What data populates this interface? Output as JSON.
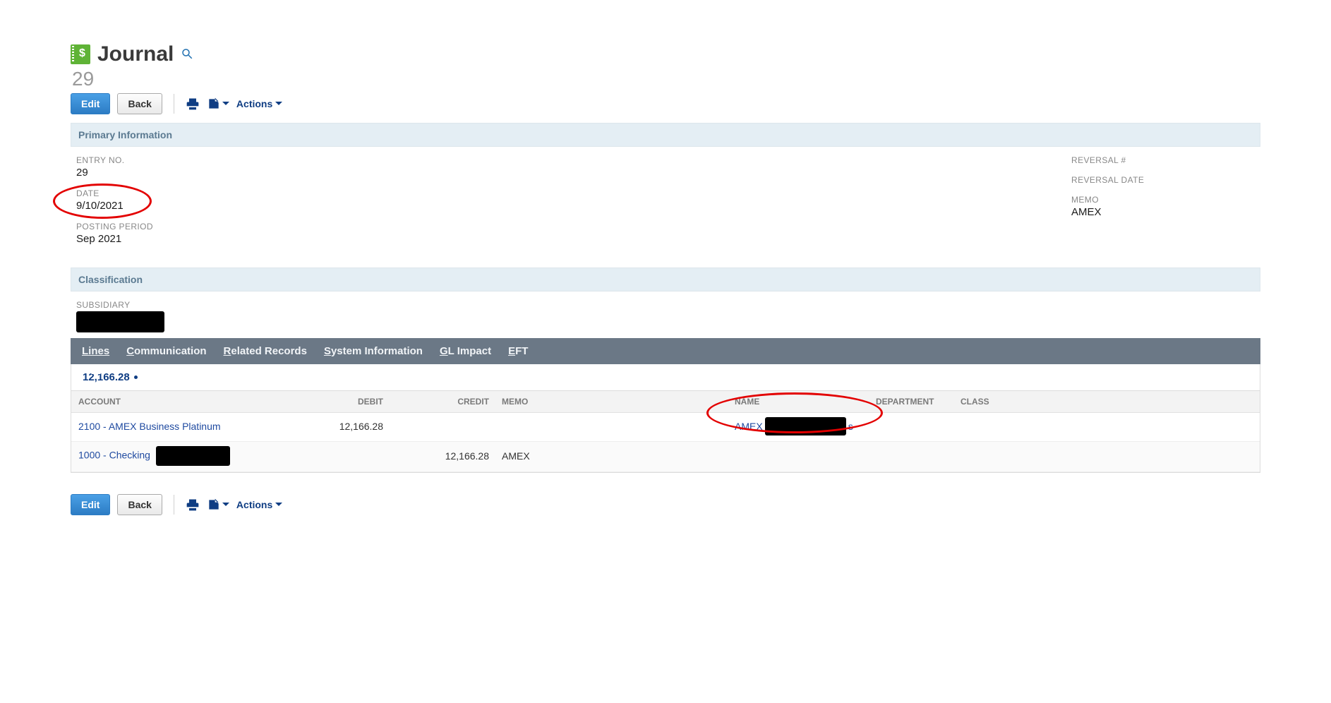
{
  "header": {
    "title": "Journal",
    "record_id": "29"
  },
  "toolbar": {
    "edit_label": "Edit",
    "back_label": "Back",
    "actions_label": "Actions"
  },
  "sections": {
    "primary_information": "Primary Information",
    "classification": "Classification"
  },
  "primary": {
    "left": {
      "entry_no_label": "ENTRY NO.",
      "entry_no_value": "29",
      "date_label": "DATE",
      "date_value": "9/10/2021",
      "posting_period_label": "POSTING PERIOD",
      "posting_period_value": "Sep 2021"
    },
    "right": {
      "reversal_no_label": "REVERSAL #",
      "reversal_no_value": "",
      "reversal_date_label": "REVERSAL DATE",
      "reversal_date_value": "",
      "memo_label": "MEMO",
      "memo_value": "AMEX"
    }
  },
  "classification": {
    "subsidiary_label": "SUBSIDIARY"
  },
  "tabs": {
    "lines": "Lines",
    "communication": "Communication",
    "related_records": "Related Records",
    "system_information": "System Information",
    "gl_impact": "GL Impact",
    "eft": "EFT"
  },
  "lines": {
    "total_display": "12,166.28",
    "columns": {
      "account": "ACCOUNT",
      "debit": "DEBIT",
      "credit": "CREDIT",
      "memo": "MEMO",
      "name": "NAME",
      "department": "DEPARTMENT",
      "class": "CLASS"
    },
    "rows": [
      {
        "account": "2100 - AMEX Business Platinum",
        "debit": "12,166.28",
        "credit": "",
        "memo": "",
        "name_prefix": "AMEX",
        "name_suffix": "s",
        "department": "",
        "class": ""
      },
      {
        "account_prefix": "1000 - Checking",
        "debit": "",
        "credit": "12,166.28",
        "memo": "AMEX",
        "name_prefix": "",
        "name_suffix": "",
        "department": "",
        "class": ""
      }
    ]
  },
  "colors": {
    "primary_button": "#2c7cc4",
    "tabstrip": "#6b7886",
    "link": "#1f4aa0",
    "section_header_bg": "#e4eef4",
    "annotation": "#e30000"
  }
}
